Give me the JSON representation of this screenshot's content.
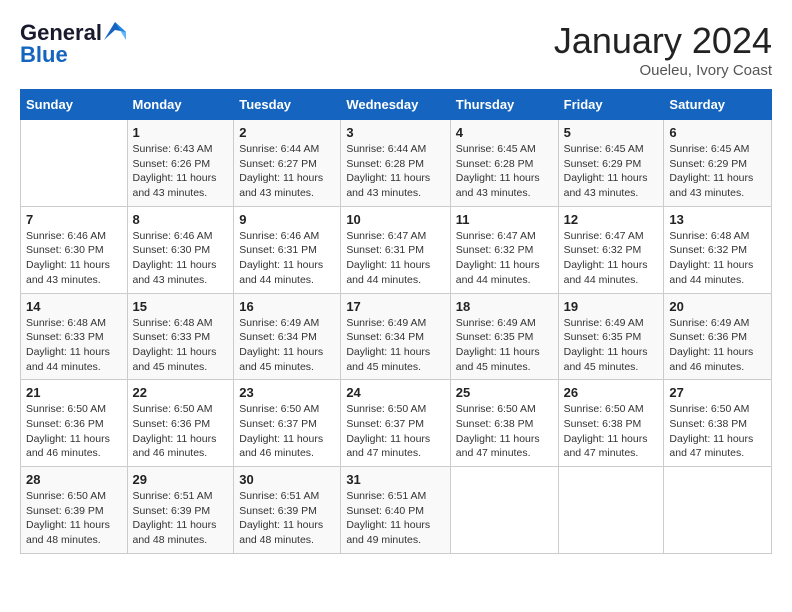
{
  "logo": {
    "line1": "General",
    "line2": "Blue"
  },
  "title": "January 2024",
  "location": "Oueleu, Ivory Coast",
  "days_of_week": [
    "Sunday",
    "Monday",
    "Tuesday",
    "Wednesday",
    "Thursday",
    "Friday",
    "Saturday"
  ],
  "weeks": [
    [
      {
        "day": "",
        "info": ""
      },
      {
        "day": "1",
        "info": "Sunrise: 6:43 AM\nSunset: 6:26 PM\nDaylight: 11 hours\nand 43 minutes."
      },
      {
        "day": "2",
        "info": "Sunrise: 6:44 AM\nSunset: 6:27 PM\nDaylight: 11 hours\nand 43 minutes."
      },
      {
        "day": "3",
        "info": "Sunrise: 6:44 AM\nSunset: 6:28 PM\nDaylight: 11 hours\nand 43 minutes."
      },
      {
        "day": "4",
        "info": "Sunrise: 6:45 AM\nSunset: 6:28 PM\nDaylight: 11 hours\nand 43 minutes."
      },
      {
        "day": "5",
        "info": "Sunrise: 6:45 AM\nSunset: 6:29 PM\nDaylight: 11 hours\nand 43 minutes."
      },
      {
        "day": "6",
        "info": "Sunrise: 6:45 AM\nSunset: 6:29 PM\nDaylight: 11 hours\nand 43 minutes."
      }
    ],
    [
      {
        "day": "7",
        "info": "Sunrise: 6:46 AM\nSunset: 6:30 PM\nDaylight: 11 hours\nand 43 minutes."
      },
      {
        "day": "8",
        "info": "Sunrise: 6:46 AM\nSunset: 6:30 PM\nDaylight: 11 hours\nand 43 minutes."
      },
      {
        "day": "9",
        "info": "Sunrise: 6:46 AM\nSunset: 6:31 PM\nDaylight: 11 hours\nand 44 minutes."
      },
      {
        "day": "10",
        "info": "Sunrise: 6:47 AM\nSunset: 6:31 PM\nDaylight: 11 hours\nand 44 minutes."
      },
      {
        "day": "11",
        "info": "Sunrise: 6:47 AM\nSunset: 6:32 PM\nDaylight: 11 hours\nand 44 minutes."
      },
      {
        "day": "12",
        "info": "Sunrise: 6:47 AM\nSunset: 6:32 PM\nDaylight: 11 hours\nand 44 minutes."
      },
      {
        "day": "13",
        "info": "Sunrise: 6:48 AM\nSunset: 6:32 PM\nDaylight: 11 hours\nand 44 minutes."
      }
    ],
    [
      {
        "day": "14",
        "info": "Sunrise: 6:48 AM\nSunset: 6:33 PM\nDaylight: 11 hours\nand 44 minutes."
      },
      {
        "day": "15",
        "info": "Sunrise: 6:48 AM\nSunset: 6:33 PM\nDaylight: 11 hours\nand 45 minutes."
      },
      {
        "day": "16",
        "info": "Sunrise: 6:49 AM\nSunset: 6:34 PM\nDaylight: 11 hours\nand 45 minutes."
      },
      {
        "day": "17",
        "info": "Sunrise: 6:49 AM\nSunset: 6:34 PM\nDaylight: 11 hours\nand 45 minutes."
      },
      {
        "day": "18",
        "info": "Sunrise: 6:49 AM\nSunset: 6:35 PM\nDaylight: 11 hours\nand 45 minutes."
      },
      {
        "day": "19",
        "info": "Sunrise: 6:49 AM\nSunset: 6:35 PM\nDaylight: 11 hours\nand 45 minutes."
      },
      {
        "day": "20",
        "info": "Sunrise: 6:49 AM\nSunset: 6:36 PM\nDaylight: 11 hours\nand 46 minutes."
      }
    ],
    [
      {
        "day": "21",
        "info": "Sunrise: 6:50 AM\nSunset: 6:36 PM\nDaylight: 11 hours\nand 46 minutes."
      },
      {
        "day": "22",
        "info": "Sunrise: 6:50 AM\nSunset: 6:36 PM\nDaylight: 11 hours\nand 46 minutes."
      },
      {
        "day": "23",
        "info": "Sunrise: 6:50 AM\nSunset: 6:37 PM\nDaylight: 11 hours\nand 46 minutes."
      },
      {
        "day": "24",
        "info": "Sunrise: 6:50 AM\nSunset: 6:37 PM\nDaylight: 11 hours\nand 47 minutes."
      },
      {
        "day": "25",
        "info": "Sunrise: 6:50 AM\nSunset: 6:38 PM\nDaylight: 11 hours\nand 47 minutes."
      },
      {
        "day": "26",
        "info": "Sunrise: 6:50 AM\nSunset: 6:38 PM\nDaylight: 11 hours\nand 47 minutes."
      },
      {
        "day": "27",
        "info": "Sunrise: 6:50 AM\nSunset: 6:38 PM\nDaylight: 11 hours\nand 47 minutes."
      }
    ],
    [
      {
        "day": "28",
        "info": "Sunrise: 6:50 AM\nSunset: 6:39 PM\nDaylight: 11 hours\nand 48 minutes."
      },
      {
        "day": "29",
        "info": "Sunrise: 6:51 AM\nSunset: 6:39 PM\nDaylight: 11 hours\nand 48 minutes."
      },
      {
        "day": "30",
        "info": "Sunrise: 6:51 AM\nSunset: 6:39 PM\nDaylight: 11 hours\nand 48 minutes."
      },
      {
        "day": "31",
        "info": "Sunrise: 6:51 AM\nSunset: 6:40 PM\nDaylight: 11 hours\nand 49 minutes."
      },
      {
        "day": "",
        "info": ""
      },
      {
        "day": "",
        "info": ""
      },
      {
        "day": "",
        "info": ""
      }
    ]
  ]
}
